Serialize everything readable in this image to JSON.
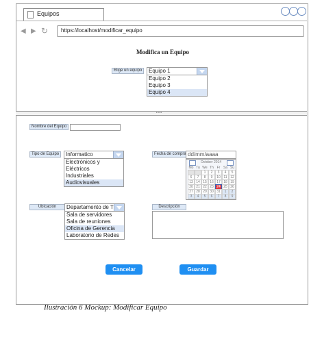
{
  "browser": {
    "tab_title": "Equipos",
    "url": "https://localhost/modificar_equipo"
  },
  "top_form": {
    "title": "Modifica un Equipo",
    "select_label": "Elige un equipo",
    "selected": "Equipo 1",
    "options": [
      "Equipo 2",
      "Equipo 3",
      "Equipo 4"
    ],
    "highlighted_option": "Equipo 4"
  },
  "form": {
    "nombre_label": "Nombre del Equipo",
    "nombre_value": "",
    "tipo_label": "Tipo de Equipo",
    "tipo_selected": "Informatico",
    "tipo_options": [
      "Electrónicos y",
      "Eléctricos",
      "Industriales",
      "Audiovisuales"
    ],
    "fecha_label": "Fecha de compra",
    "fecha_placeholder": "dd/mm/aaaa",
    "ubicacion_label": "Ubicación",
    "ubicacion_selected": "Departamento de TI",
    "ubicacion_options": [
      "Sala de servidores",
      "Sala de reuniones",
      "Oficina de Gerencia",
      "Laboratorio de Redes"
    ],
    "descripcion_label": "Descripción",
    "descripcion_value": ""
  },
  "calendar": {
    "month_label": "October 2014",
    "weekdays": [
      "Mo",
      "Tu",
      "We",
      "Th",
      "Fr",
      "Sa",
      "Su"
    ],
    "rows": [
      [
        "",
        "",
        "1",
        "2",
        "3",
        "4",
        "5"
      ],
      [
        "6",
        "7",
        "8",
        "9",
        "10",
        "11",
        "12"
      ],
      [
        "13",
        "14",
        "15",
        "16",
        "17",
        "18",
        "19"
      ],
      [
        "20",
        "21",
        "22",
        "23",
        "24",
        "25",
        "26"
      ],
      [
        "27",
        "28",
        "29",
        "30",
        "31",
        "1",
        "2"
      ],
      [
        "3",
        "4",
        "5",
        "6",
        "7",
        "8",
        "9"
      ]
    ],
    "selected_day": "24"
  },
  "buttons": {
    "cancel": "Cancelar",
    "save": "Guardar"
  },
  "caption": "Ilustración 6 Mockup: Modificar Equipo",
  "colors": {
    "button_bg": "#1f8ff2",
    "label_bg": "#dde8f6",
    "highlight": "#dbe6f6",
    "selected_day": "#e1373f"
  }
}
